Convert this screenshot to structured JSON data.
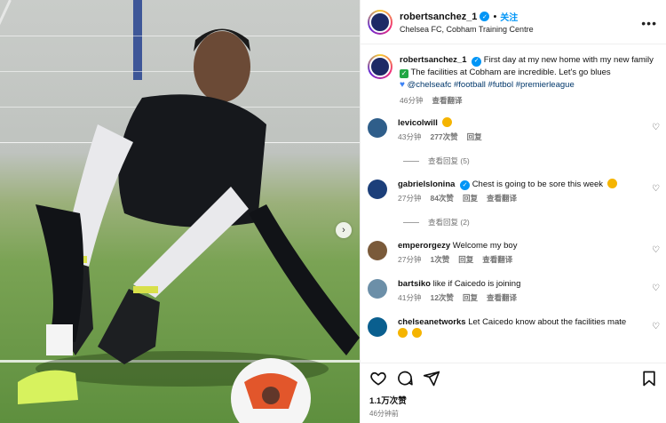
{
  "post": {
    "username": "robertsanchez_1",
    "follow_label": "关注",
    "location": "Chelsea FC, Cobham Training Centre",
    "more_label": "•••"
  },
  "caption": {
    "username": "robertsanchez_1",
    "text_part1": "First day at my new home with my new family",
    "text_part2": "The facilities at Cobham are incredible. Let's go blues",
    "tags": "@chelseafc #football #futbol #premierleague",
    "time": "46分钟",
    "translate": "查看翻译"
  },
  "comments": [
    {
      "user": "levicolwill",
      "text": "",
      "time": "43分钟",
      "likes": "277次赞",
      "reply": "回复",
      "translate": "",
      "replies": "查看回复 (5)",
      "pic_color": "#2f5e8a"
    },
    {
      "user": "gabrielslonina",
      "text": "Chest is going to be sore this week",
      "time": "27分钟",
      "likes": "84次赞",
      "reply": "回复",
      "translate": "查看翻译",
      "replies": "查看回复 (2)",
      "pic_color": "#1c3f7a"
    },
    {
      "user": "emperorgezy",
      "text": "Welcome my boy",
      "time": "27分钟",
      "likes": "1次赞",
      "reply": "回复",
      "translate": "查看翻译",
      "replies": "",
      "pic_color": "#7a5a3a"
    },
    {
      "user": "bartsiko",
      "text": "like if Caicedo is joining",
      "time": "41分钟",
      "likes": "12次赞",
      "reply": "回复",
      "translate": "查看翻译",
      "replies": "",
      "pic_color": "#6c8fa8"
    },
    {
      "user": "chelseanetworks",
      "text": "Let Caicedo know about the facilities mate",
      "time": "",
      "likes": "",
      "reply": "",
      "translate": "",
      "replies": "",
      "pic_color": "#0a5f8f"
    }
  ],
  "footer": {
    "likes": "1.1万次赞",
    "time": "46分钟前"
  },
  "icons": [
    "heart-icon",
    "comment-icon",
    "share-icon",
    "bookmark-icon",
    "chevron-right-icon",
    "verified-icon"
  ],
  "colors": {
    "accent": "#0095f6",
    "tag": "#00376b",
    "muted": "#737373"
  }
}
